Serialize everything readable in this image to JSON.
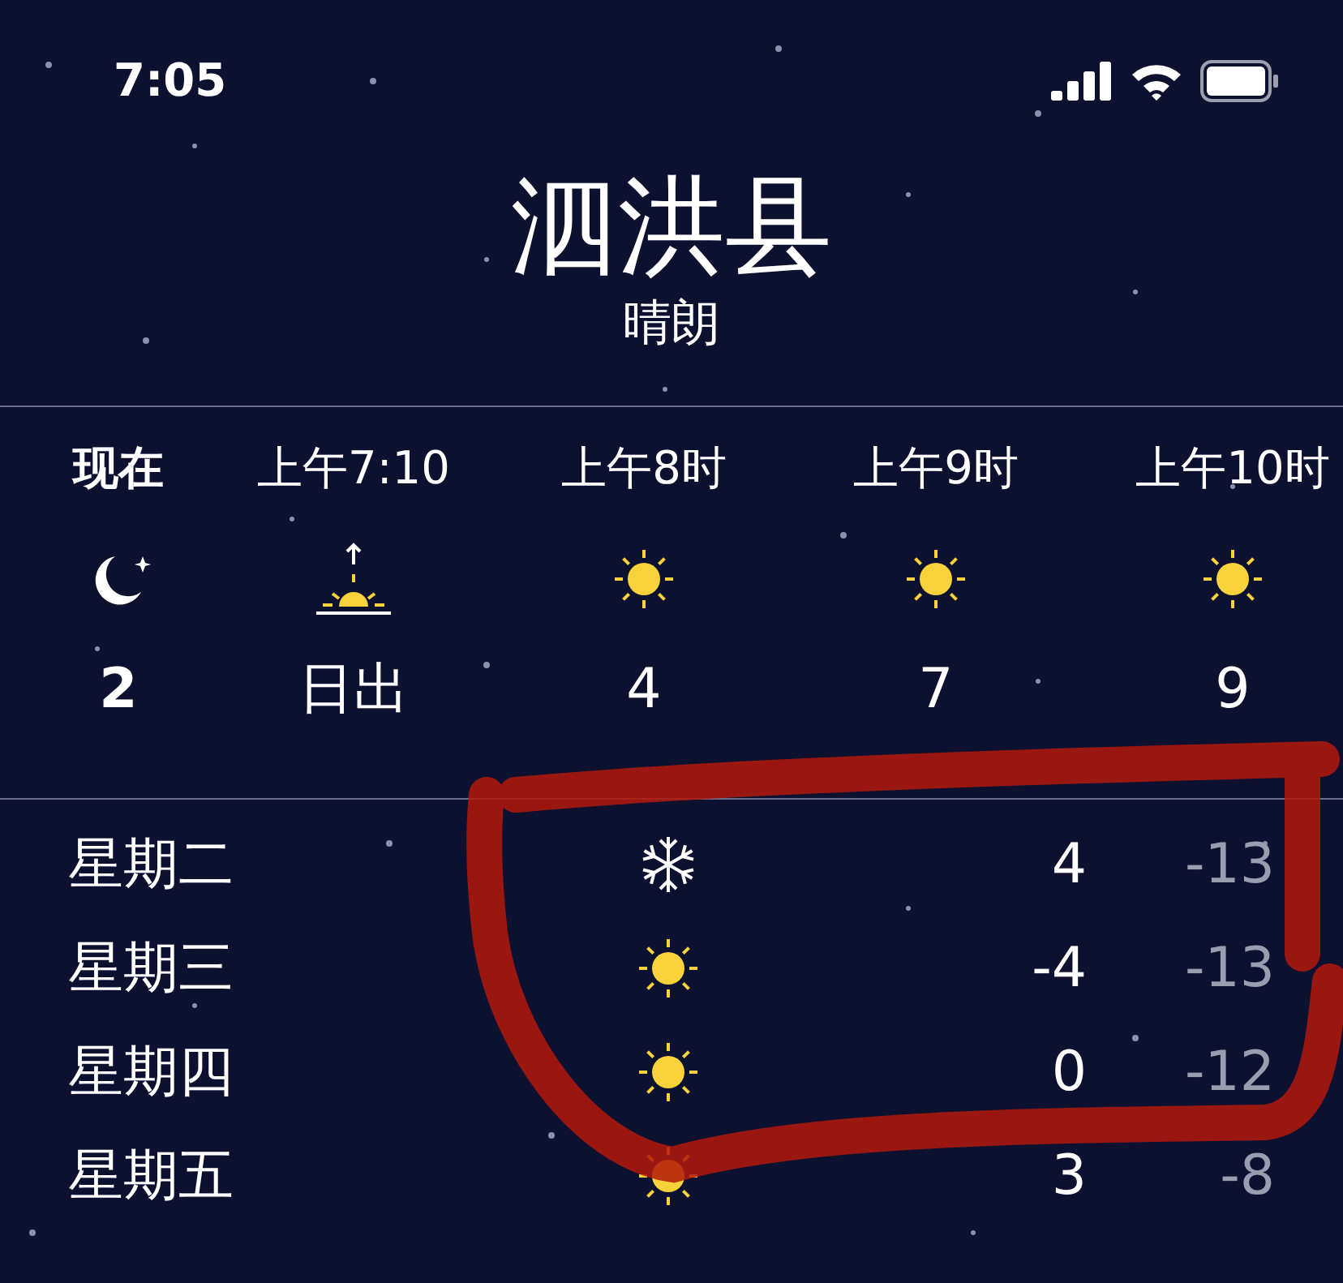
{
  "status_bar": {
    "time": "7:05"
  },
  "location": {
    "city": "泗洪县",
    "condition": "晴朗"
  },
  "hourly": [
    {
      "label": "现在",
      "kind": "moon",
      "temp": "2",
      "selected": true
    },
    {
      "label": "上午7:10",
      "kind": "sunrise",
      "temp": "日出",
      "selected": false
    },
    {
      "label": "上午8时",
      "kind": "sun",
      "temp": "4",
      "selected": false
    },
    {
      "label": "上午9时",
      "kind": "sun",
      "temp": "7",
      "selected": false
    },
    {
      "label": "上午10时",
      "kind": "sun",
      "temp": "9",
      "selected": false
    }
  ],
  "daily": [
    {
      "day": "星期二",
      "kind": "snow",
      "high": "4",
      "low": "-13"
    },
    {
      "day": "星期三",
      "kind": "sun",
      "high": "-4",
      "low": "-13"
    },
    {
      "day": "星期四",
      "kind": "sun",
      "high": "0",
      "low": "-12"
    },
    {
      "day": "星期五",
      "kind": "sun",
      "high": "3",
      "low": "-8"
    }
  ]
}
